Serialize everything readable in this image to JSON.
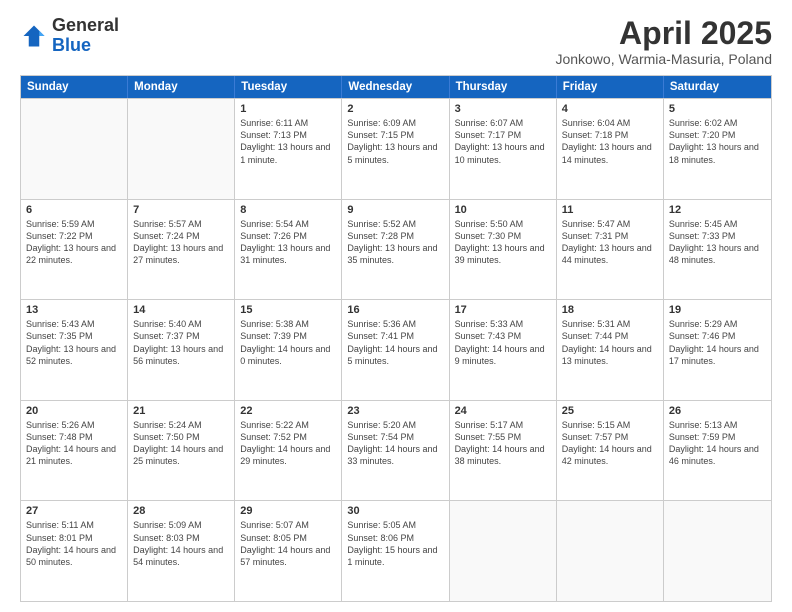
{
  "logo": {
    "general": "General",
    "blue": "Blue"
  },
  "title": "April 2025",
  "subtitle": "Jonkowo, Warmia-Masuria, Poland",
  "days": [
    "Sunday",
    "Monday",
    "Tuesday",
    "Wednesday",
    "Thursday",
    "Friday",
    "Saturday"
  ],
  "weeks": [
    [
      {
        "day": "",
        "text": ""
      },
      {
        "day": "",
        "text": ""
      },
      {
        "day": "1",
        "text": "Sunrise: 6:11 AM\nSunset: 7:13 PM\nDaylight: 13 hours and 1 minute."
      },
      {
        "day": "2",
        "text": "Sunrise: 6:09 AM\nSunset: 7:15 PM\nDaylight: 13 hours and 5 minutes."
      },
      {
        "day": "3",
        "text": "Sunrise: 6:07 AM\nSunset: 7:17 PM\nDaylight: 13 hours and 10 minutes."
      },
      {
        "day": "4",
        "text": "Sunrise: 6:04 AM\nSunset: 7:18 PM\nDaylight: 13 hours and 14 minutes."
      },
      {
        "day": "5",
        "text": "Sunrise: 6:02 AM\nSunset: 7:20 PM\nDaylight: 13 hours and 18 minutes."
      }
    ],
    [
      {
        "day": "6",
        "text": "Sunrise: 5:59 AM\nSunset: 7:22 PM\nDaylight: 13 hours and 22 minutes."
      },
      {
        "day": "7",
        "text": "Sunrise: 5:57 AM\nSunset: 7:24 PM\nDaylight: 13 hours and 27 minutes."
      },
      {
        "day": "8",
        "text": "Sunrise: 5:54 AM\nSunset: 7:26 PM\nDaylight: 13 hours and 31 minutes."
      },
      {
        "day": "9",
        "text": "Sunrise: 5:52 AM\nSunset: 7:28 PM\nDaylight: 13 hours and 35 minutes."
      },
      {
        "day": "10",
        "text": "Sunrise: 5:50 AM\nSunset: 7:30 PM\nDaylight: 13 hours and 39 minutes."
      },
      {
        "day": "11",
        "text": "Sunrise: 5:47 AM\nSunset: 7:31 PM\nDaylight: 13 hours and 44 minutes."
      },
      {
        "day": "12",
        "text": "Sunrise: 5:45 AM\nSunset: 7:33 PM\nDaylight: 13 hours and 48 minutes."
      }
    ],
    [
      {
        "day": "13",
        "text": "Sunrise: 5:43 AM\nSunset: 7:35 PM\nDaylight: 13 hours and 52 minutes."
      },
      {
        "day": "14",
        "text": "Sunrise: 5:40 AM\nSunset: 7:37 PM\nDaylight: 13 hours and 56 minutes."
      },
      {
        "day": "15",
        "text": "Sunrise: 5:38 AM\nSunset: 7:39 PM\nDaylight: 14 hours and 0 minutes."
      },
      {
        "day": "16",
        "text": "Sunrise: 5:36 AM\nSunset: 7:41 PM\nDaylight: 14 hours and 5 minutes."
      },
      {
        "day": "17",
        "text": "Sunrise: 5:33 AM\nSunset: 7:43 PM\nDaylight: 14 hours and 9 minutes."
      },
      {
        "day": "18",
        "text": "Sunrise: 5:31 AM\nSunset: 7:44 PM\nDaylight: 14 hours and 13 minutes."
      },
      {
        "day": "19",
        "text": "Sunrise: 5:29 AM\nSunset: 7:46 PM\nDaylight: 14 hours and 17 minutes."
      }
    ],
    [
      {
        "day": "20",
        "text": "Sunrise: 5:26 AM\nSunset: 7:48 PM\nDaylight: 14 hours and 21 minutes."
      },
      {
        "day": "21",
        "text": "Sunrise: 5:24 AM\nSunset: 7:50 PM\nDaylight: 14 hours and 25 minutes."
      },
      {
        "day": "22",
        "text": "Sunrise: 5:22 AM\nSunset: 7:52 PM\nDaylight: 14 hours and 29 minutes."
      },
      {
        "day": "23",
        "text": "Sunrise: 5:20 AM\nSunset: 7:54 PM\nDaylight: 14 hours and 33 minutes."
      },
      {
        "day": "24",
        "text": "Sunrise: 5:17 AM\nSunset: 7:55 PM\nDaylight: 14 hours and 38 minutes."
      },
      {
        "day": "25",
        "text": "Sunrise: 5:15 AM\nSunset: 7:57 PM\nDaylight: 14 hours and 42 minutes."
      },
      {
        "day": "26",
        "text": "Sunrise: 5:13 AM\nSunset: 7:59 PM\nDaylight: 14 hours and 46 minutes."
      }
    ],
    [
      {
        "day": "27",
        "text": "Sunrise: 5:11 AM\nSunset: 8:01 PM\nDaylight: 14 hours and 50 minutes."
      },
      {
        "day": "28",
        "text": "Sunrise: 5:09 AM\nSunset: 8:03 PM\nDaylight: 14 hours and 54 minutes."
      },
      {
        "day": "29",
        "text": "Sunrise: 5:07 AM\nSunset: 8:05 PM\nDaylight: 14 hours and 57 minutes."
      },
      {
        "day": "30",
        "text": "Sunrise: 5:05 AM\nSunset: 8:06 PM\nDaylight: 15 hours and 1 minute."
      },
      {
        "day": "",
        "text": ""
      },
      {
        "day": "",
        "text": ""
      },
      {
        "day": "",
        "text": ""
      }
    ]
  ]
}
